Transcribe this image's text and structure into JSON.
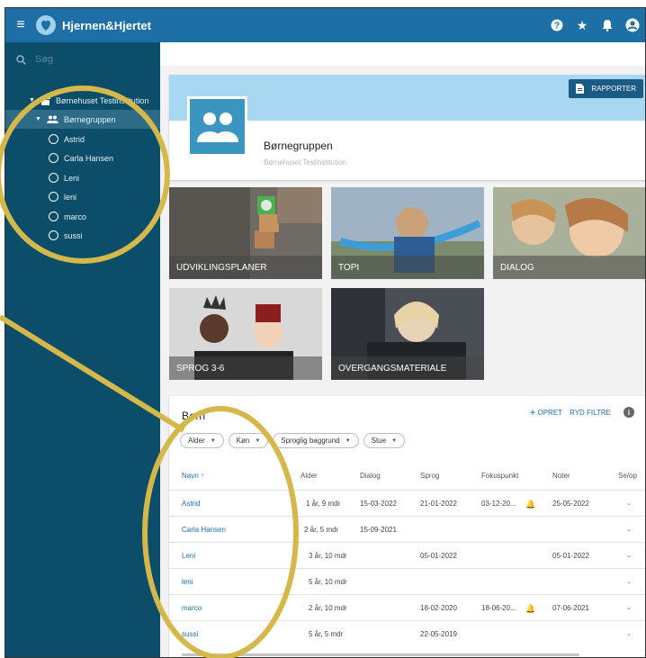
{
  "app": {
    "title": "Hjernen&Hjertet"
  },
  "sidebar": {
    "search_placeholder": "Søg",
    "institution": "Børnehuset Testinstitution",
    "group": "Børnegruppen",
    "children": [
      "Astrid",
      "Carla Hansen",
      "Leni",
      "leni",
      "marco",
      "sussi"
    ]
  },
  "header": {
    "report_button": "RAPPORTER",
    "group_name": "Børnegruppen",
    "institution": "Børnehuset Testinstitution"
  },
  "tiles": [
    "UDVIKLINGSPLANER",
    "TOPI",
    "DIALOG",
    "SPROG 3-6",
    "OVERGANGSMATERIALE"
  ],
  "children_card": {
    "title": "Børn",
    "create": "OPRET",
    "clear_filters": "RYD FILTRE",
    "filters": [
      "Alder",
      "Køn",
      "Sproglig baggrund",
      "Stue"
    ],
    "columns": [
      "Navn",
      "Alder",
      "Dialog",
      "Sprog",
      "Fokuspunkt",
      "Noter",
      "Se/op"
    ],
    "rows": [
      {
        "name": "Astrid",
        "age": "1 år, 9 mdr",
        "dialog": "15-03-2022",
        "sprog": "21-01-2022",
        "fokus": "03-12-20...",
        "noter": "25-05-2022"
      },
      {
        "name": "Carla Hansen",
        "age": "2 år, 5 mdr",
        "dialog": "15-09-2021",
        "sprog": "",
        "fokus": "",
        "noter": ""
      },
      {
        "name": "Leni",
        "age": "3 år, 10 mdr",
        "dialog": "",
        "sprog": "05-01-2022",
        "fokus": "",
        "noter": "05-01-2022"
      },
      {
        "name": "leni",
        "age": "5 år, 10 mdr",
        "dialog": "",
        "sprog": "",
        "fokus": "",
        "noter": ""
      },
      {
        "name": "marco",
        "age": "2 år, 10 mdr",
        "dialog": "",
        "sprog": "18-02-2020",
        "fokus": "18-06-20...",
        "noter": "07-06-2021"
      },
      {
        "name": "sussi",
        "age": "5 år, 5 mdr",
        "dialog": "",
        "sprog": "22-05-2019",
        "fokus": "",
        "noter": ""
      }
    ]
  },
  "colors": {
    "topbar": "#1d6fa5",
    "sidebar": "#0c4d6a",
    "link": "#1a72a8",
    "annotation": "#d4b84a",
    "alert": "#e53935"
  }
}
